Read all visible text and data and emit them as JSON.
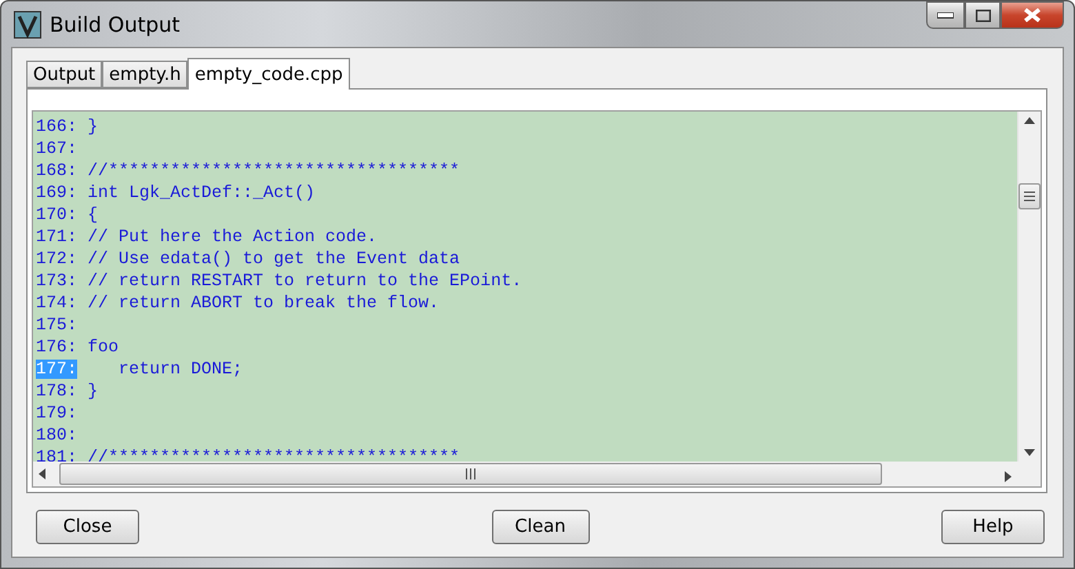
{
  "window": {
    "title": "Build Output"
  },
  "tabs": [
    {
      "label": "Output",
      "selected": false
    },
    {
      "label": "empty.h",
      "selected": false
    },
    {
      "label": "empty_code.cpp",
      "selected": true
    }
  ],
  "code_lines": [
    {
      "number": "166:",
      "text": "}",
      "selected": false
    },
    {
      "number": "167:",
      "selected": false
    },
    {
      "number": "168:",
      "text": "//**********************************",
      "selected": false
    },
    {
      "number": "169:",
      "text": "int Lgk_ActDef::_Act()",
      "selected": false
    },
    {
      "number": "170:",
      "text": "{",
      "selected": false
    },
    {
      "number": "171:",
      "text": "// Put here the Action code.",
      "selected": false
    },
    {
      "number": "172:",
      "text": "// Use edata() to get the Event data",
      "selected": false
    },
    {
      "number": "173:",
      "text": "// return RESTART to return to the EPoint.",
      "selected": false
    },
    {
      "number": "174:",
      "text": "// return ABORT to break the flow.",
      "selected": false
    },
    {
      "number": "175:",
      "selected": false
    },
    {
      "number": "176:",
      "text": "foo",
      "selected": false
    },
    {
      "number": "177:",
      "text": "   return DONE;",
      "selected": true
    },
    {
      "number": "178:",
      "text": "}",
      "selected": false
    },
    {
      "number": "179:",
      "selected": false
    },
    {
      "number": "180:",
      "selected": false
    },
    {
      "number": "181:",
      "text": "//**********************************",
      "selected": false
    }
  ],
  "buttons": [
    {
      "label": "Close"
    },
    {
      "label": "Clean"
    },
    {
      "label": "Help"
    }
  ]
}
